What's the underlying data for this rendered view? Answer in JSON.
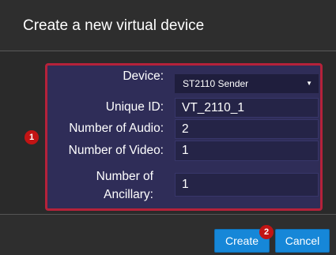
{
  "dialog": {
    "title": "Create a new virtual device"
  },
  "form": {
    "device_label": "Device:",
    "device_value": "ST2110 Sender",
    "unique_id_label": "Unique ID:",
    "unique_id_value": "VT_2110_1",
    "audio_label": "Number of Audio:",
    "audio_value": "2",
    "video_label": "Number of Video:",
    "video_value": "1",
    "ancillary_label_line1": "Number of",
    "ancillary_label_line2": "Ancillary:",
    "ancillary_value": "1"
  },
  "footer": {
    "create_label": "Create",
    "cancel_label": "Cancel"
  },
  "annotations": {
    "badge_1": "1",
    "badge_2": "2"
  },
  "colors": {
    "highlight": "#b5223a",
    "badge": "#c21414",
    "button": "#1687d8",
    "panel": "#2f2d58"
  }
}
